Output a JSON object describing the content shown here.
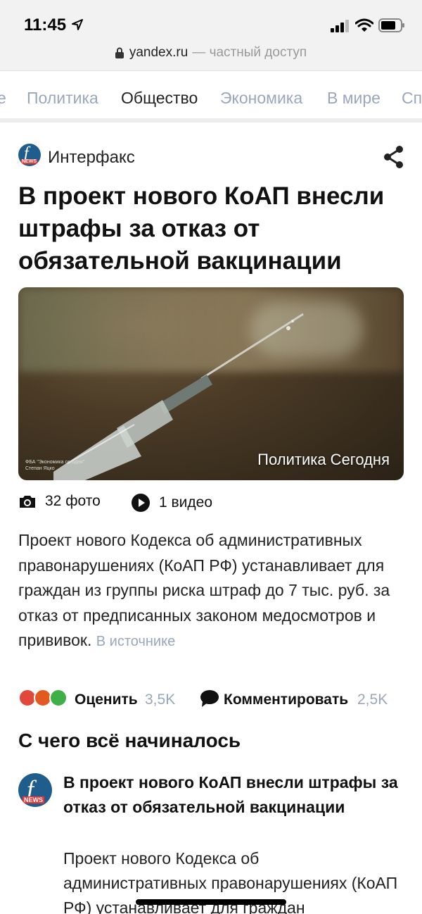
{
  "status_bar": {
    "time": "11:45"
  },
  "url_bar": {
    "domain": "yandex.ru",
    "suffix": "— частный доступ"
  },
  "tabs": [
    {
      "label": "е"
    },
    {
      "label": "Политика"
    },
    {
      "label": "Общество",
      "active": true
    },
    {
      "label": "Экономика"
    },
    {
      "label": "В мире"
    },
    {
      "label": "Сп"
    }
  ],
  "article": {
    "source": "Интерфакс",
    "headline": "В проект нового КоАП внесли штрафы за отказ от обязательной вакцинации",
    "image_caption": "Политика Сегодня",
    "image_credit_line1": "ФБА \"Экономика сегодня\"",
    "image_credit_line2": "Степан Яцко",
    "photos": "32 фото",
    "videos": "1 видео",
    "summary": "Проект нового Кодекса об административных правонарушениях (КоАП РФ) устанавливает для граждан из группы риска штраф до 7 тыс. руб. за отказ от предписанных законом медосмотров и прививок.",
    "source_link": "В источнике",
    "rate_label": "Оценить",
    "rate_count": "3,5K",
    "comment_label": "Комментировать",
    "comment_count": "2,5K"
  },
  "related_section": {
    "title": "С чего всё начиналось",
    "items": [
      {
        "title": "В проект нового КоАП внесли штрафы за отказ от обязательной вакцинации",
        "text": "Проект нового Кодекса об административных правонарушениях (КоАП РФ) устанавливает для граждан"
      }
    ]
  },
  "logo_text": {
    "letter": "f",
    "badge": "NEWS"
  },
  "colors": {
    "accent_gray": "#9aa6bd",
    "logo_blue": "#1f5d8c",
    "logo_red": "#e33333"
  }
}
